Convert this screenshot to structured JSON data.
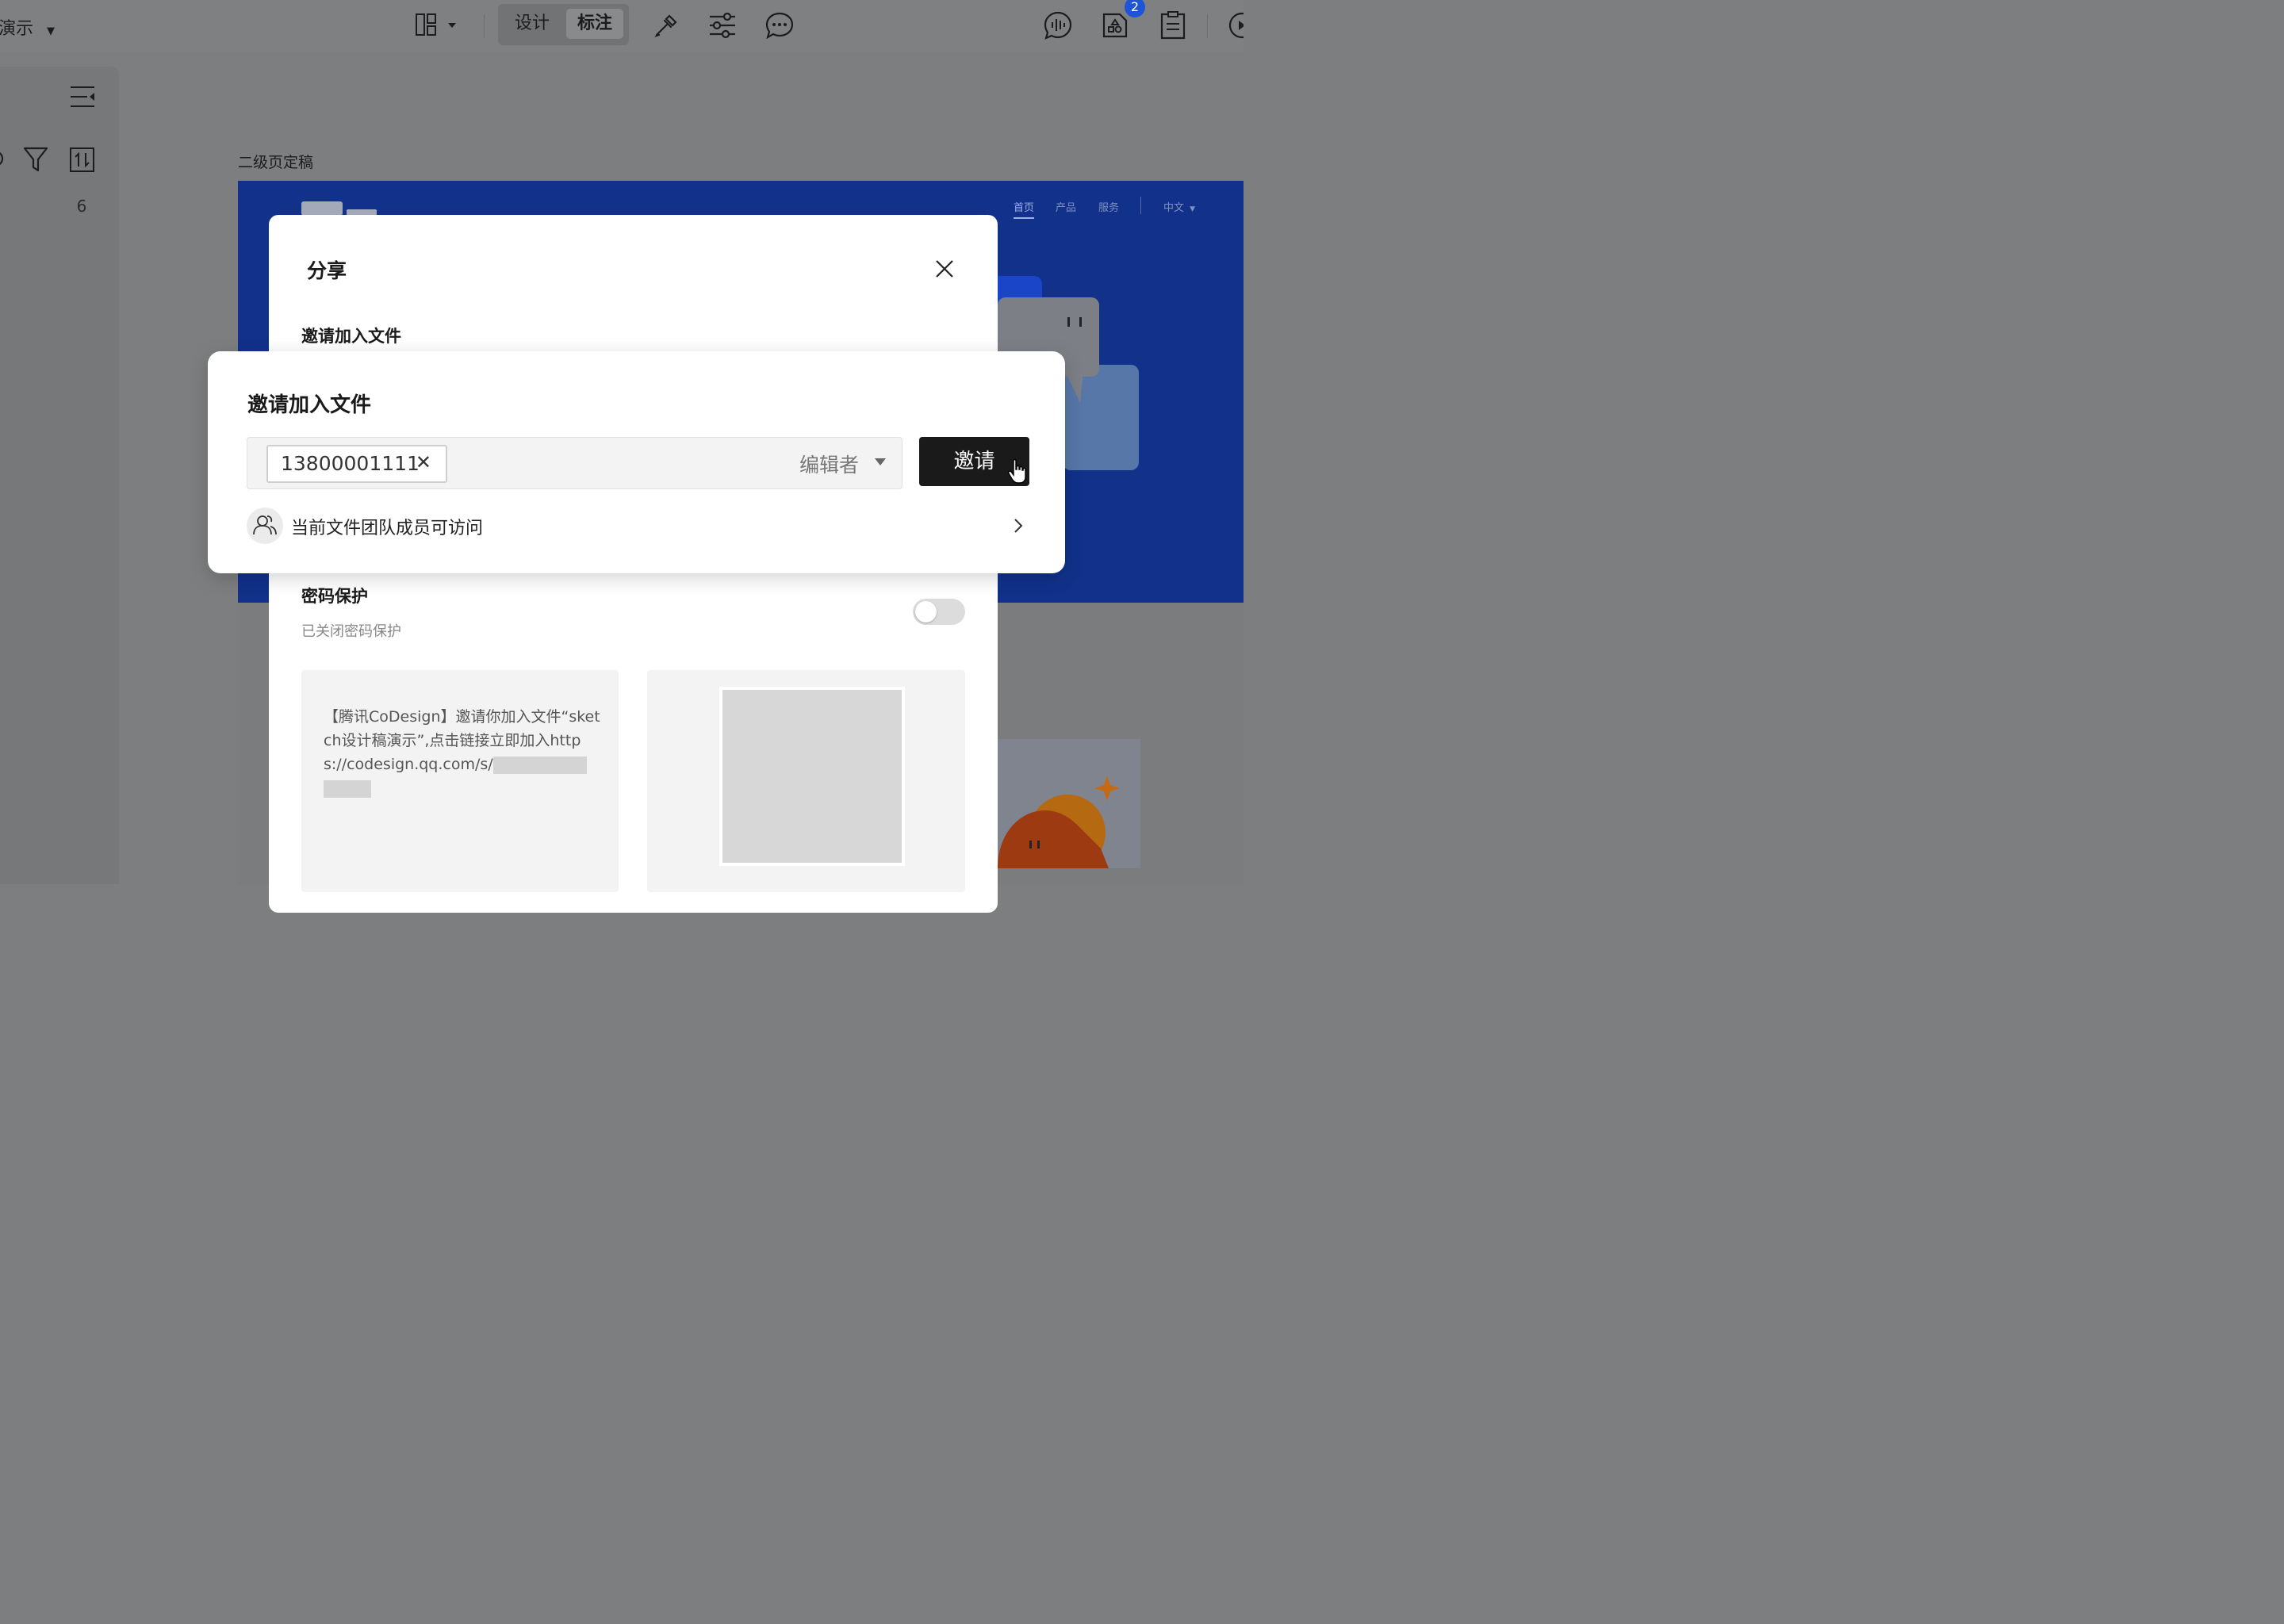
{
  "toolbar": {
    "left_label": "演示",
    "tabs": [
      {
        "label": "设计",
        "active": false
      },
      {
        "label": "标注",
        "active": true
      }
    ],
    "notification_badge": "2"
  },
  "left_panel": {
    "count": "6"
  },
  "canvas": {
    "page_label": "二级页定稿",
    "nav_items": [
      "首页",
      "产品",
      "服务",
      "中文"
    ]
  },
  "share_dialog": {
    "title": "分享",
    "invite_section_title": "邀请加入文件",
    "password_title": "密码保护",
    "password_desc": "已关闭密码保护",
    "password_enabled": false,
    "link_text": "【腾讯CoDesign】邀请你加入文件“sketch设计稿演示”,点击链接立即加入https://codesign.qq.com/s/"
  },
  "invite_dialog": {
    "title": "邀请加入文件",
    "invitee": "13800001111",
    "role": "编辑者",
    "invite_button": "邀请",
    "access_text": "当前文件团队成员可访问"
  },
  "colors": {
    "artboard_blue": "#11318a",
    "invite_button_bg": "#1a1a1a",
    "badge": "#1e55d6"
  }
}
